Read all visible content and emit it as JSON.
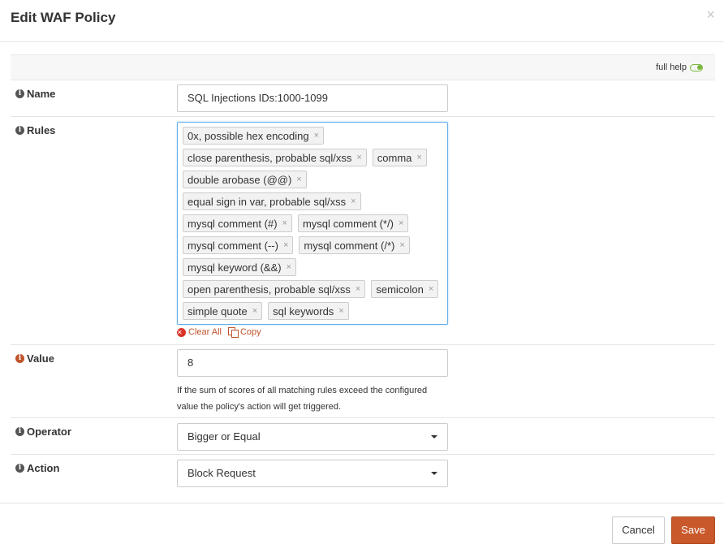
{
  "dialog": {
    "title": "Edit WAF Policy",
    "close_label": "×"
  },
  "help": {
    "label": "full help",
    "enabled": true
  },
  "fields": {
    "name": {
      "label": "Name",
      "value": "SQL Injections IDs:1000-1099"
    },
    "rules": {
      "label": "Rules",
      "lines": [
        [
          "0x, possible hex encoding"
        ],
        [
          "close parenthesis, probable sql/xss",
          "comma"
        ],
        [
          "double arobase (@@)"
        ],
        [
          "equal sign in var, probable sql/xss"
        ],
        [
          "mysql comment (#)",
          "mysql comment (*/)"
        ],
        [
          "mysql comment (--)",
          "mysql comment (/*)"
        ],
        [
          "mysql keyword (&&)"
        ],
        [
          "open parenthesis, probable sql/xss",
          "semicolon"
        ],
        [
          "simple quote",
          "sql keywords"
        ]
      ],
      "remove_label": "×",
      "clear_all": "Clear All",
      "copy": "Copy"
    },
    "value": {
      "label": "Value",
      "value": "8",
      "help": "If the sum of scores of all matching rules exceed the configured value the policy's action will get triggered."
    },
    "operator": {
      "label": "Operator",
      "selected": "Bigger or Equal"
    },
    "action": {
      "label": "Action",
      "selected": "Block Request"
    }
  },
  "buttons": {
    "cancel": "Cancel",
    "save": "Save"
  },
  "colors": {
    "accent": "#c9582b",
    "focus_border": "#66afe9",
    "toggle_on": "#79b63d"
  }
}
